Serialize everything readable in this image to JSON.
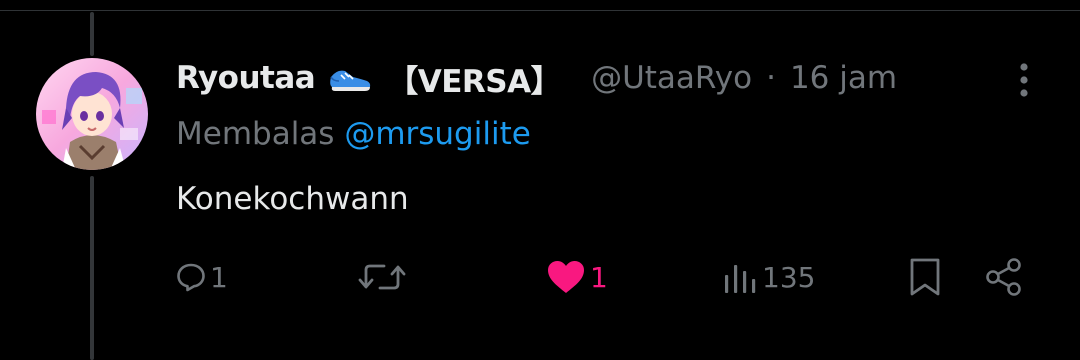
{
  "tweet": {
    "display_name": "Ryoutaa",
    "name_tag": "【VERSA】",
    "handle": "@UtaaRyo",
    "separator": "·",
    "time": "16 jam",
    "reply_prefix": "Membalas",
    "reply_mention": "@mrsugilite",
    "text": "Konekochwann"
  },
  "actions": {
    "reply_count": "1",
    "like_count": "1",
    "view_count": "135"
  },
  "icons": {
    "header_emoji": "running-shoe-icon",
    "more": "more-vertical-icon",
    "reply": "reply-icon",
    "retweet": "retweet-icon",
    "like": "heart-icon",
    "views": "views-icon",
    "bookmark": "bookmark-icon",
    "share": "share-icon"
  },
  "colors": {
    "background": "#000000",
    "text": "#e7e9ea",
    "muted": "#71767b",
    "link": "#1d9bf0",
    "like": "#f91880"
  }
}
